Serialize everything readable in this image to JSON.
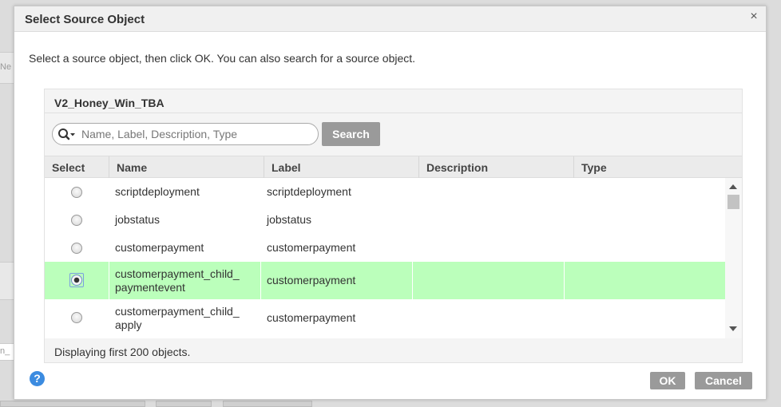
{
  "background": {
    "left_tab_text": "Ne",
    "left_field_text": "n_"
  },
  "dialog": {
    "title": "Select Source Object",
    "close_glyph": "×",
    "instruction": "Select a source object, then click OK. You can also search for a source object.",
    "connection_name": "V2_Honey_Win_TBA",
    "search": {
      "placeholder": "Name, Label, Description, Type",
      "value": "",
      "button_label": "Search"
    },
    "columns": [
      "Select",
      "Name",
      "Label",
      "Description",
      "Type"
    ],
    "rows": [
      {
        "selected": false,
        "name": "scriptdeployment",
        "label": "scriptdeployment",
        "description": "",
        "type": ""
      },
      {
        "selected": false,
        "name": "jobstatus",
        "label": "jobstatus",
        "description": "",
        "type": ""
      },
      {
        "selected": false,
        "name": "customerpayment",
        "label": "customerpayment",
        "description": "",
        "type": ""
      },
      {
        "selected": true,
        "name": "customerpayment_child_\npaymentevent",
        "label": "customerpayment",
        "description": "",
        "type": ""
      },
      {
        "selected": false,
        "name": "customerpayment_child_\napply",
        "label": "customerpayment",
        "description": "",
        "type": ""
      }
    ],
    "status": "Displaying first 200 objects.",
    "help_glyph": "?",
    "ok_label": "OK",
    "cancel_label": "Cancel",
    "colors": {
      "selected_row": "#bbffbb",
      "button_gray": "#9a9a9a",
      "help_blue": "#3b8be0"
    }
  }
}
